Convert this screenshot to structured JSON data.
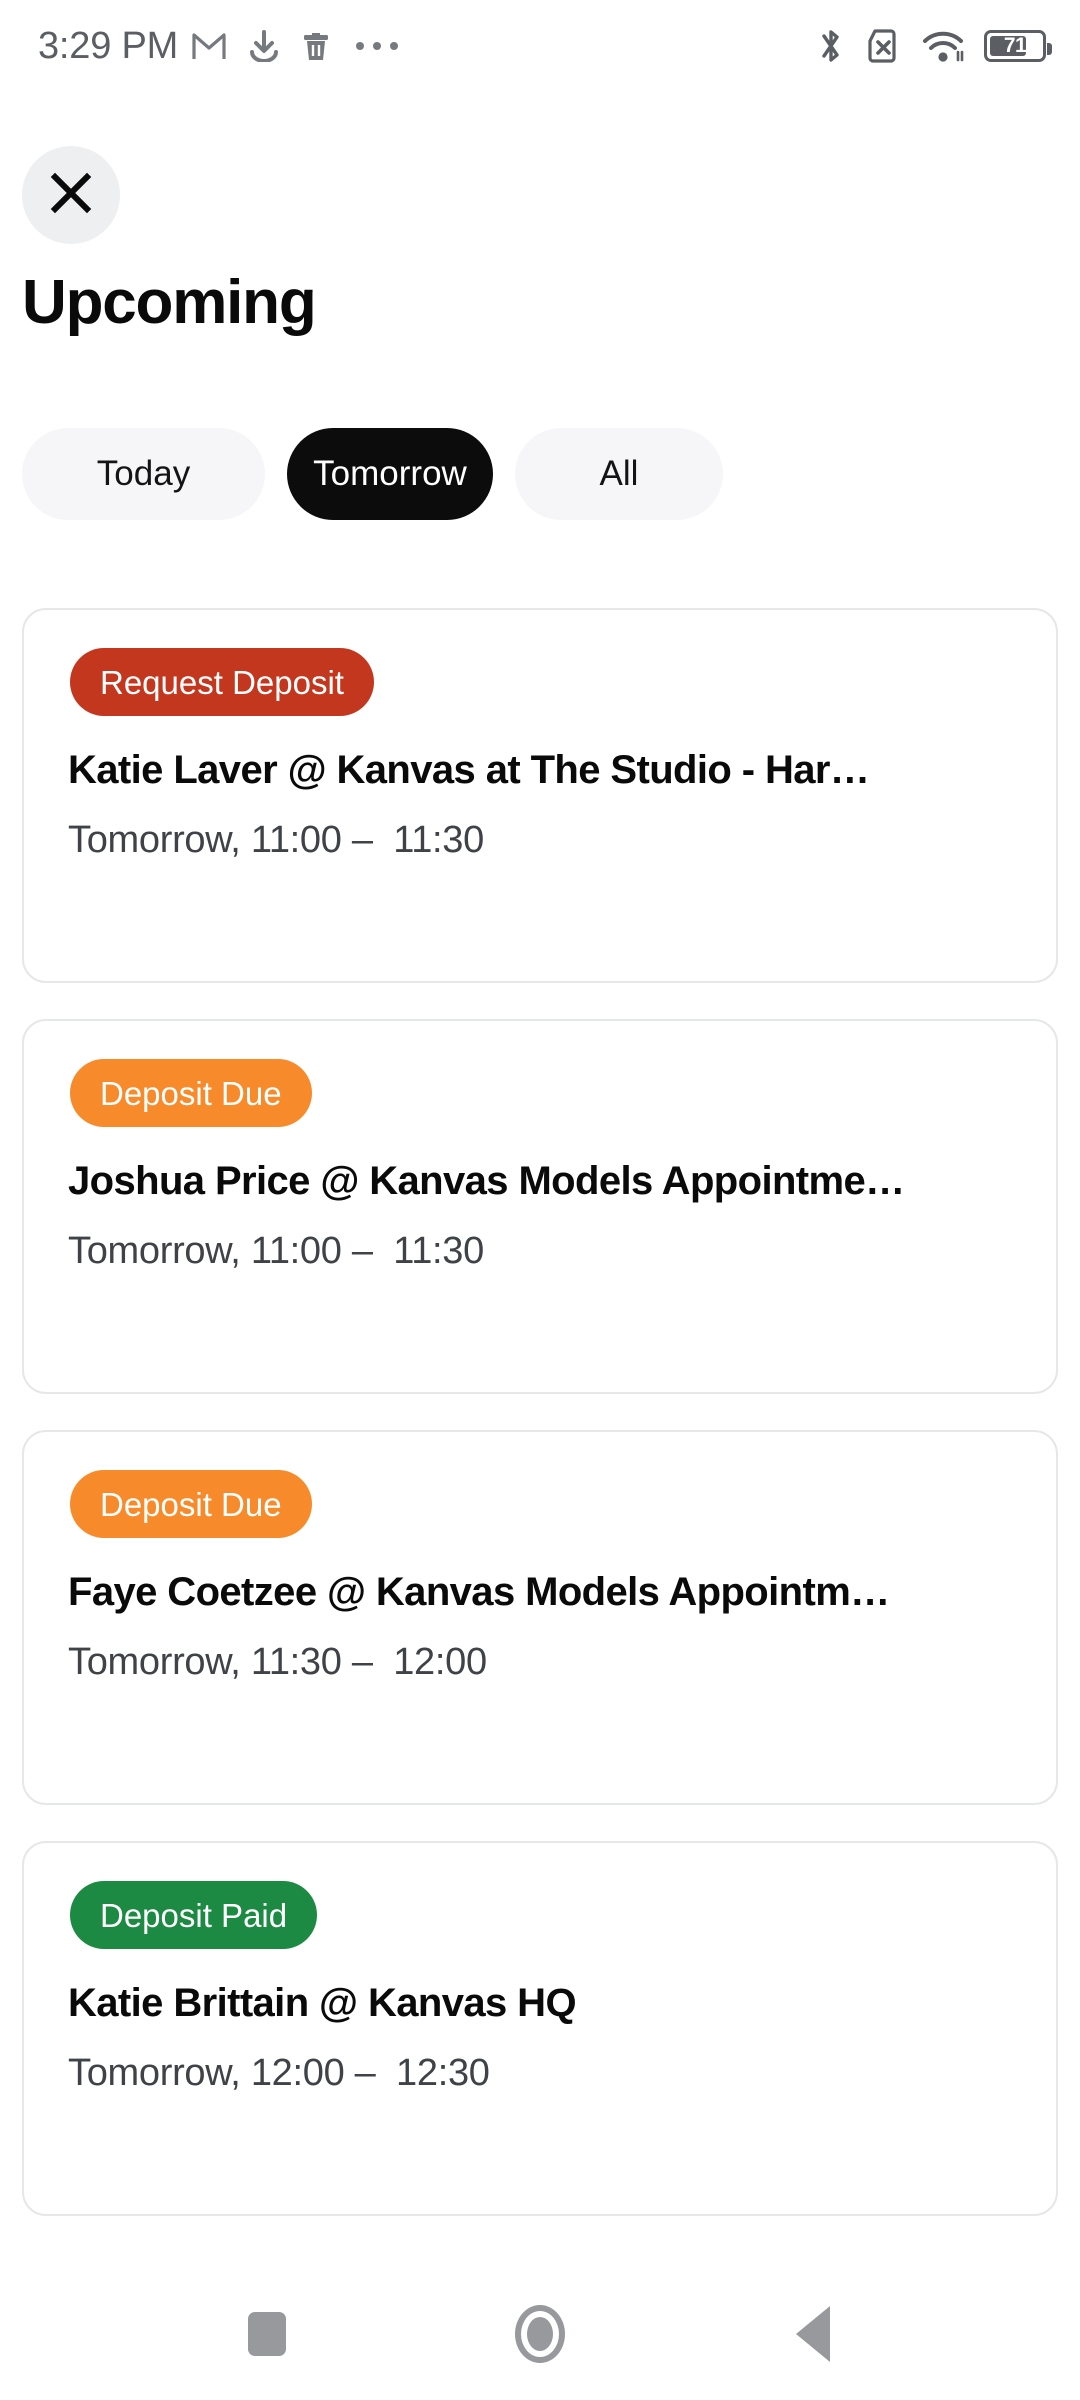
{
  "status_bar": {
    "time": "3:29 PM",
    "battery_level": "71",
    "left_icons": [
      "gmail-icon",
      "download-icon",
      "trash-icon",
      "overflow-dots-icon"
    ],
    "right_icons": [
      "bluetooth-icon",
      "no-sim-icon",
      "wifi-icon",
      "battery-icon"
    ]
  },
  "header": {
    "close_icon": "close-icon",
    "title": "Upcoming"
  },
  "tabs": [
    {
      "label": "Today",
      "selected": false
    },
    {
      "label": "Tomorrow",
      "selected": true
    },
    {
      "label": "All",
      "selected": false
    }
  ],
  "colors": {
    "badge_request_deposit": "#c4371f",
    "badge_deposit_due": "#f78b2c",
    "badge_deposit_paid": "#1d8a43",
    "tab_active_bg": "#0c0c0c",
    "tab_inactive_bg": "#f6f6f9",
    "card_border": "#e6e7e9",
    "close_btn_bg": "#eeeff1"
  },
  "cards": [
    {
      "badge": "Request Deposit",
      "badge_color": "#c4371f",
      "title": "Katie  Laver @ Kanvas at The Studio - Har…",
      "time": "Tomorrow, 11:00 –  11:30"
    },
    {
      "badge": "Deposit Due",
      "badge_color": "#f78b2c",
      "title": "Joshua Price @ Kanvas Models Appointme…",
      "time": "Tomorrow, 11:00 –  11:30"
    },
    {
      "badge": "Deposit Due",
      "badge_color": "#f78b2c",
      "title": "Faye  Coetzee @ Kanvas Models Appointm…",
      "time": "Tomorrow, 11:30 –  12:00"
    },
    {
      "badge": "Deposit Paid",
      "badge_color": "#1d8a43",
      "title": "Katie Brittain @ Kanvas HQ",
      "time": "Tomorrow, 12:00 –  12:30"
    }
  ],
  "nav_bar": {
    "recents_icon": "square-recents-icon",
    "home_icon": "circle-home-icon",
    "back_icon": "triangle-back-icon"
  }
}
